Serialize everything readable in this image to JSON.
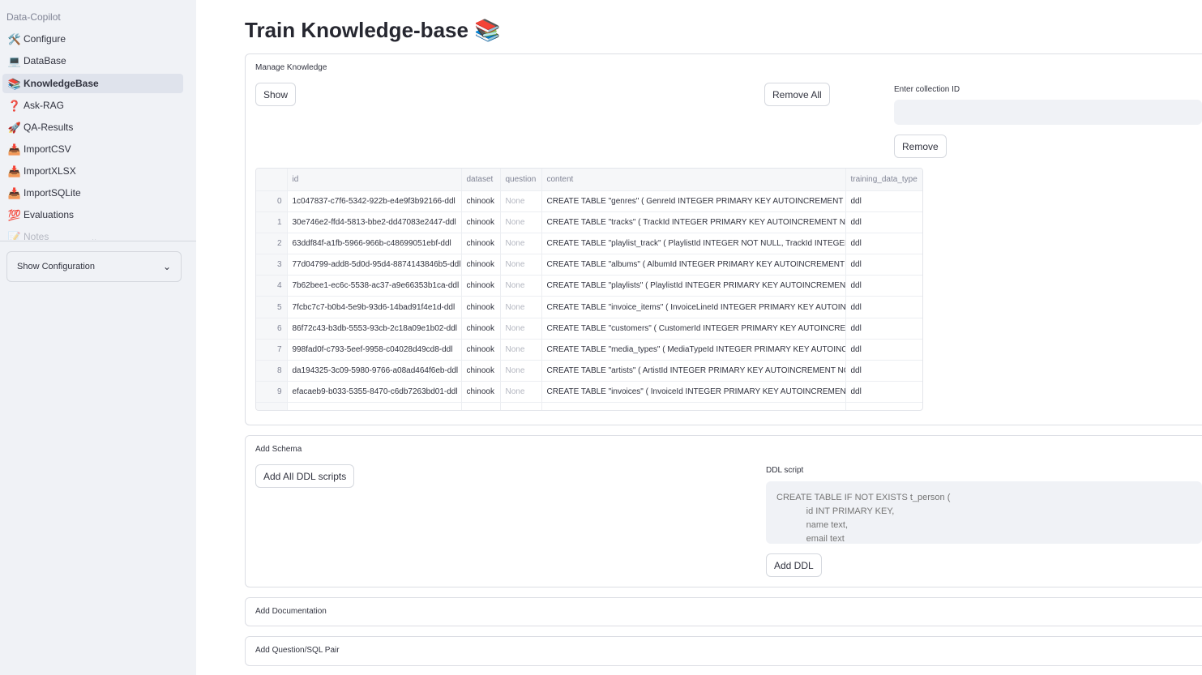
{
  "sidebar": {
    "app_name": "Data-Copilot",
    "items": [
      {
        "icon": "🛠️",
        "icon_name": "tools-icon",
        "label": "Configure"
      },
      {
        "icon": "💻",
        "icon_name": "laptop-icon",
        "label": "DataBase"
      },
      {
        "icon": "📚",
        "icon_name": "books-icon",
        "label": "KnowledgeBase"
      },
      {
        "icon": "❓",
        "icon_name": "question-icon",
        "label": "Ask-RAG"
      },
      {
        "icon": "🚀",
        "icon_name": "rocket-icon",
        "label": "QA-Results"
      },
      {
        "icon": "📥",
        "icon_name": "inbox-icon",
        "label": "ImportCSV"
      },
      {
        "icon": "📥",
        "icon_name": "inbox-icon",
        "label": "ImportXLSX"
      },
      {
        "icon": "📥",
        "icon_name": "inbox-icon",
        "label": "ImportSQLite"
      },
      {
        "icon": "💯",
        "icon_name": "hundred-icon",
        "label": "Evaluations"
      },
      {
        "icon": "📝",
        "icon_name": "memo-icon",
        "label": "Notes"
      }
    ],
    "active_item": "KnowledgeBase",
    "expand_icon": "⌄",
    "config_expander": {
      "label": "Show Configuration",
      "icon": "⌄"
    }
  },
  "page": {
    "title": "Train Knowledge-base 📚"
  },
  "manage": {
    "label": "Manage Knowledge",
    "show_button": "Show",
    "remove_all_button": "Remove All",
    "collection_label": "Enter collection ID",
    "collection_value": "",
    "remove_button": "Remove",
    "table": {
      "columns": [
        "",
        "id",
        "dataset",
        "question",
        "content",
        "training_data_type"
      ],
      "rows": [
        [
          "0",
          "1c047837-c7f6-5342-922b-e4e9f3b92166-ddl",
          "chinook",
          "None",
          "CREATE TABLE \"genres\" (    GenreId INTEGER PRIMARY KEY AUTOINCREMENT NOT NULL",
          "ddl"
        ],
        [
          "1",
          "30e746e2-ffd4-5813-bbe2-dd47083e2447-ddl",
          "chinook",
          "None",
          "CREATE TABLE \"tracks\" (    TrackId INTEGER PRIMARY KEY AUTOINCREMENT NOT NULL",
          "ddl"
        ],
        [
          "2",
          "63ddf84f-a1fb-5966-966b-c48699051ebf-ddl",
          "chinook",
          "None",
          "CREATE TABLE \"playlist_track\" (    PlaylistId INTEGER  NOT NULL,    TrackId INTEGER",
          "ddl"
        ],
        [
          "3",
          "77d04799-add8-5d0d-95d4-8874143846b5-ddl",
          "chinook",
          "None",
          "CREATE TABLE \"albums\" (    AlbumId INTEGER PRIMARY KEY AUTOINCREMENT NOT NULL",
          "ddl"
        ],
        [
          "4",
          "7b62bee1-ec6c-5538-ac37-a9e66353b1ca-ddl",
          "chinook",
          "None",
          "CREATE TABLE \"playlists\" (    PlaylistId INTEGER PRIMARY KEY AUTOINCREMENT NOT NULL",
          "ddl"
        ],
        [
          "5",
          "7fcbc7c7-b0b4-5e9b-93d6-14bad91f4e1d-ddl",
          "chinook",
          "None",
          "CREATE TABLE \"invoice_items\" (    InvoiceLineId INTEGER PRIMARY KEY AUTOINCREMENT",
          "ddl"
        ],
        [
          "6",
          "86f72c43-b3db-5553-93cb-2c18a09e1b02-ddl",
          "chinook",
          "None",
          "CREATE TABLE \"customers\" (    CustomerId INTEGER PRIMARY KEY AUTOINCREMENT",
          "ddl"
        ],
        [
          "7",
          "998fad0f-c793-5eef-9958-c04028d49cd8-ddl",
          "chinook",
          "None",
          "CREATE TABLE \"media_types\" (    MediaTypeId INTEGER PRIMARY KEY AUTOINCREMENT",
          "ddl"
        ],
        [
          "8",
          "da194325-3c09-5980-9766-a08ad464f6eb-ddl",
          "chinook",
          "None",
          "CREATE TABLE \"artists\" (    ArtistId INTEGER PRIMARY KEY AUTOINCREMENT NOT NULL",
          "ddl"
        ],
        [
          "9",
          "efacaeb9-b033-5355-8470-c6db7263bd01-ddl",
          "chinook",
          "None",
          "CREATE TABLE \"invoices\" (    InvoiceId INTEGER PRIMARY KEY AUTOINCREMENT NOT NULL",
          "ddl"
        ]
      ]
    }
  },
  "schema": {
    "label": "Add Schema",
    "add_all_button": "Add All DDL scripts",
    "ddl_label": "DDL script",
    "ddl_placeholder": "CREATE TABLE IF NOT EXISTS t_person (\n            id INT PRIMARY KEY,\n            name text,\n            email text\n);",
    "add_ddl_button": "Add DDL"
  },
  "documentation": {
    "label": "Add Documentation"
  },
  "qa_pair": {
    "label": "Add Question/SQL Pair"
  }
}
